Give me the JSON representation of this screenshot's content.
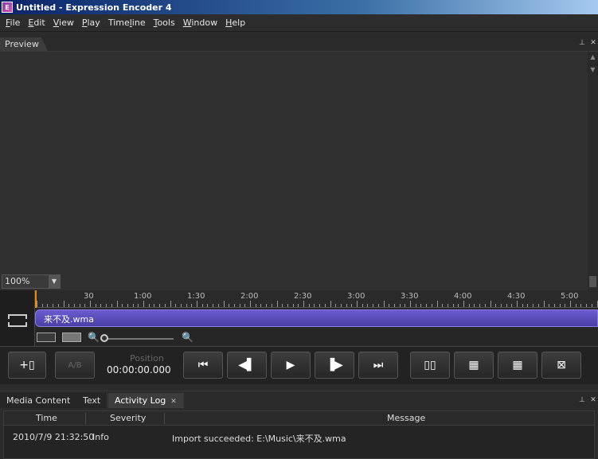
{
  "window": {
    "title": "Untitled - Expression Encoder 4"
  },
  "menu": [
    {
      "label": "File",
      "u": "F",
      "rest": "ile"
    },
    {
      "label": "Edit",
      "u": "E",
      "rest": "dit"
    },
    {
      "label": "View",
      "u": "V",
      "rest": "iew"
    },
    {
      "label": "Play",
      "u": "P",
      "rest": "lay"
    },
    {
      "label": "Timeline",
      "pre": "Time",
      "u": "l",
      "rest": "ine"
    },
    {
      "label": "Tools",
      "u": "T",
      "rest": "ools"
    },
    {
      "label": "Window",
      "u": "W",
      "rest": "indow"
    },
    {
      "label": "Help",
      "u": "H",
      "rest": "elp"
    }
  ],
  "preview": {
    "tab": "Preview",
    "zoom": "100%"
  },
  "timeline": {
    "ticks": [
      "30",
      "1:00",
      "1:30",
      "2:00",
      "2:30",
      "3:00",
      "3:30",
      "4:00",
      "4:30",
      "5:00"
    ],
    "clip": "来不及.wma"
  },
  "transport": {
    "ab_label": "A/B",
    "position_label": "Position",
    "position_value": "00:00:00.000"
  },
  "bottom": {
    "tabs": [
      "Media Content",
      "Text",
      "Activity Log"
    ],
    "active_tab": "Activity Log",
    "columns": [
      "Time",
      "Severity",
      "Message"
    ],
    "rows": [
      {
        "time": "2010/7/9 21:32:50",
        "severity": "Info",
        "message": "Import succeeded: E:\\Music\\来不及.wma"
      }
    ]
  }
}
